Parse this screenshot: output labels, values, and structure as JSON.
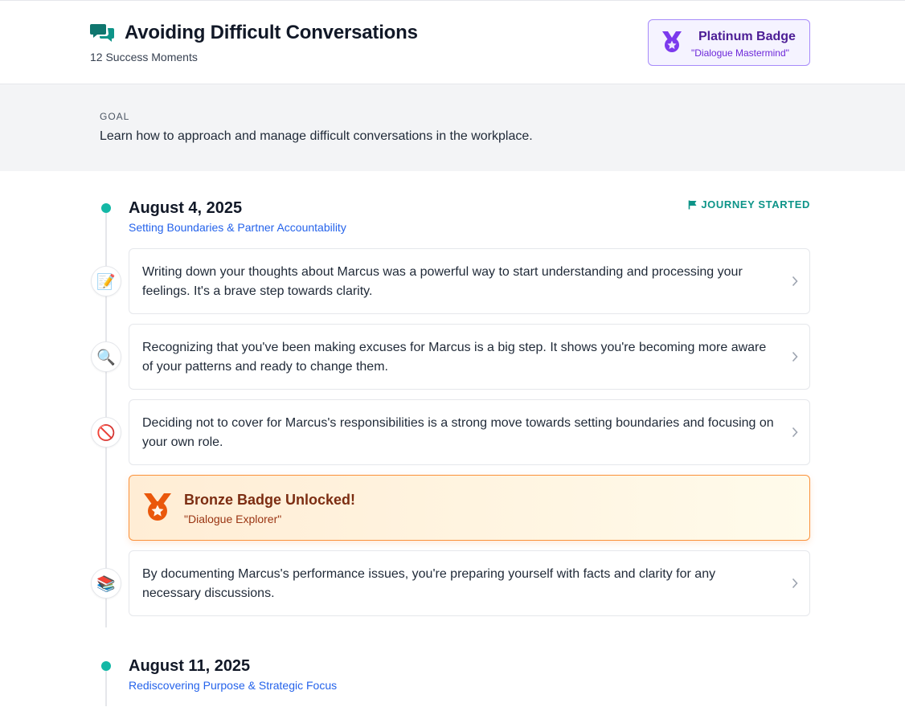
{
  "header": {
    "title": "Avoiding Difficult Conversations",
    "subtitle": "12 Success Moments",
    "title_icon": "chat-bubbles-icon"
  },
  "platinum_badge": {
    "title": "Platinum Badge",
    "subtitle": "\"Dialogue Mastermind\"",
    "icon": "medal-icon",
    "color": "#7c3aed"
  },
  "goal": {
    "label": "GOAL",
    "text": "Learn how to approach and manage difficult conversations in the workplace."
  },
  "sections": [
    {
      "date": "August 4, 2025",
      "topic": "Setting Boundaries & Partner Accountability",
      "status": "JOURNEY STARTED",
      "status_icon": "flag-icon",
      "moments": [
        {
          "icon": "📝",
          "icon_name": "memo-icon",
          "text": "Writing down your thoughts about Marcus was a powerful way to start understanding and processing your feelings. It's a brave step towards clarity."
        },
        {
          "icon": "🔍",
          "icon_name": "magnifier-icon",
          "text": "Recognizing that you've been making excuses for Marcus is a big step. It shows you're becoming more aware of your patterns and ready to change them."
        },
        {
          "icon": "🚫",
          "icon_name": "prohibited-icon",
          "text": "Deciding not to cover for Marcus's responsibilities is a strong move towards setting boundaries and focusing on your own role."
        },
        {
          "icon": "📚",
          "icon_name": "books-icon",
          "text": "By documenting Marcus's performance issues, you're preparing yourself with facts and clarity for any necessary discussions."
        }
      ],
      "badge": {
        "title": "Bronze Badge Unlocked!",
        "subtitle": "\"Dialogue Explorer\"",
        "color": "#ea580c"
      }
    },
    {
      "date": "August 11, 2025",
      "topic": "Rediscovering Purpose & Strategic Focus"
    }
  ],
  "colors": {
    "accent_teal": "#14b8a6",
    "link_blue": "#2563eb"
  }
}
